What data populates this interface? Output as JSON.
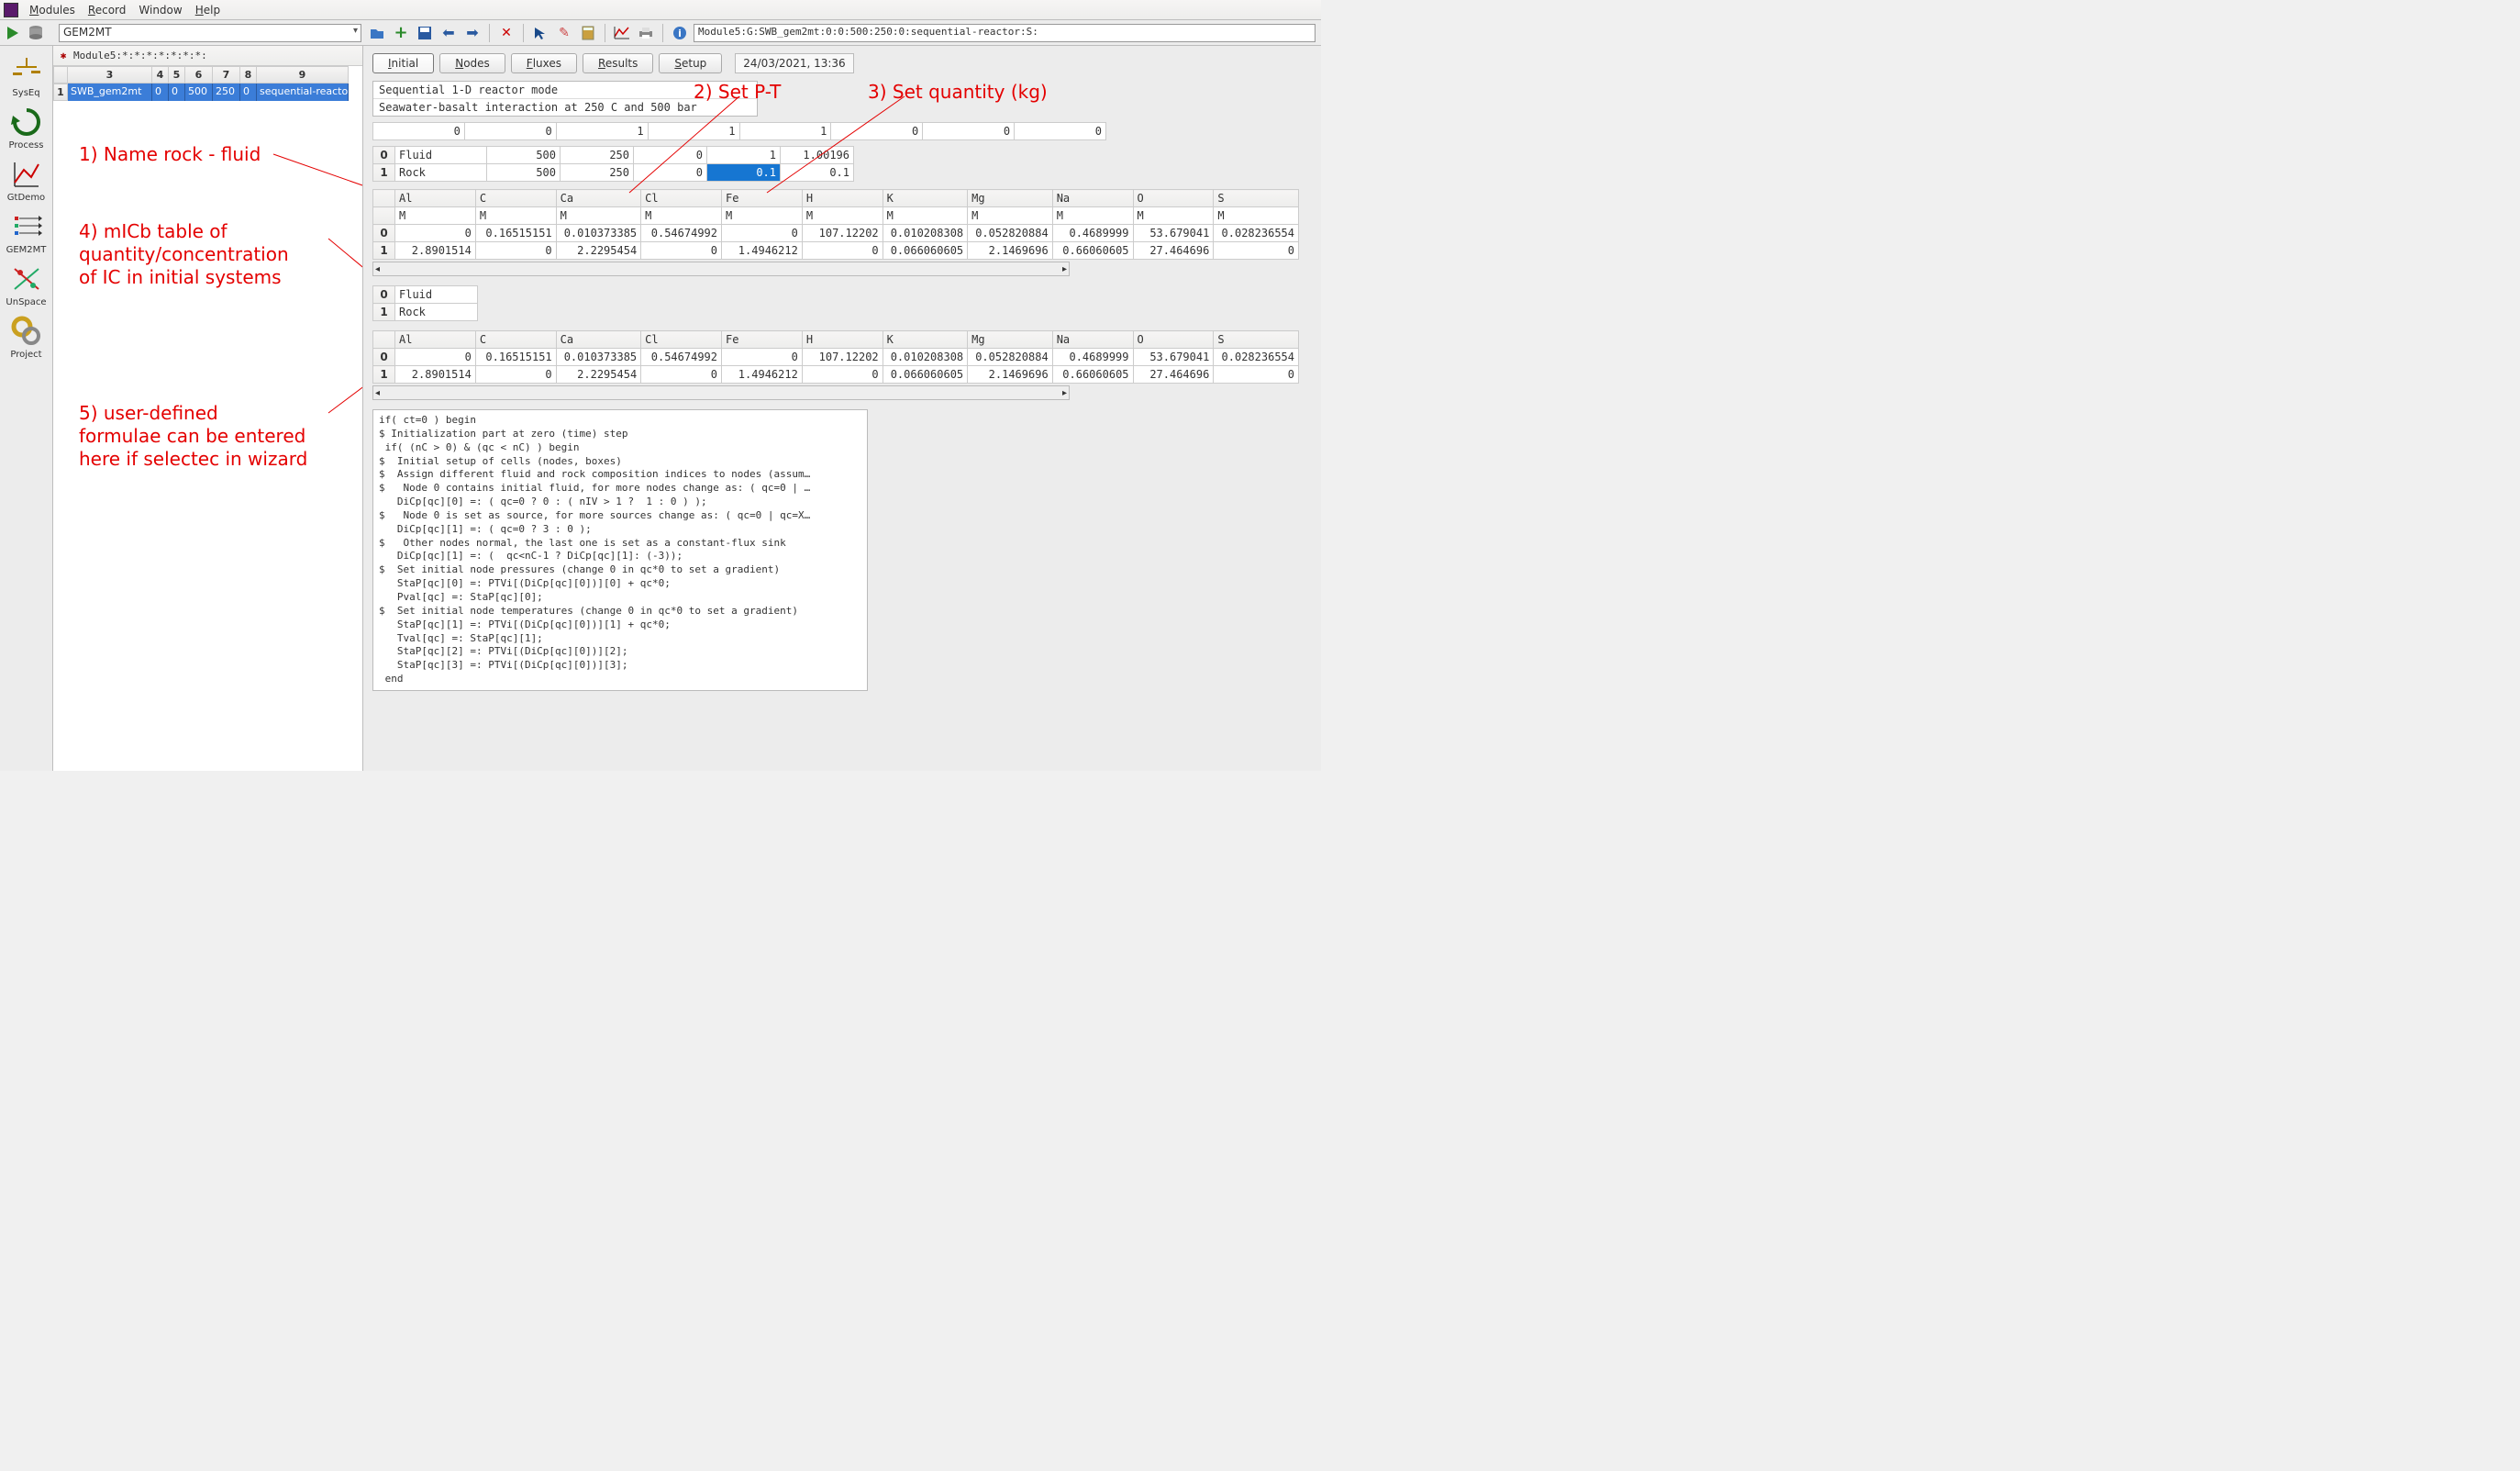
{
  "menu": {
    "modules": "Modules",
    "record": "Record",
    "window": "Window",
    "help": "Help"
  },
  "module_combo": "GEM2MT",
  "module_path": "Module5:G:SWB_gem2mt:0:0:500:250:0:sequential-reactor:S:",
  "record_header_label": "Module5:*:*:*:*:*:*:*:",
  "record_columns": [
    "",
    "3",
    "4",
    "5",
    "6",
    "7",
    "8",
    "9"
  ],
  "record_row": {
    "idx": "1",
    "cells": [
      "SWB_gem2mt",
      "0",
      "0",
      "500",
      "250",
      "0",
      "sequential-reactor"
    ]
  },
  "side": [
    {
      "key": "syseq",
      "label": "SysEq"
    },
    {
      "key": "process",
      "label": "Process"
    },
    {
      "key": "gtdemo",
      "label": "GtDemo"
    },
    {
      "key": "gem2mt",
      "label": "GEM2MT"
    },
    {
      "key": "unspace",
      "label": "UnSpace"
    },
    {
      "key": "project",
      "label": "Project"
    }
  ],
  "tabs": {
    "initial": "Initial",
    "nodes": "Nodes",
    "fluxes": "Fluxes",
    "results": "Results",
    "setup": "Setup"
  },
  "date_label": "24/03/2021, 13:36",
  "desc": {
    "line1": "Sequential 1-D reactor mode",
    "line2": "Seawater-basalt interaction at 250 C and 500 bar"
  },
  "toprow": [
    "0",
    "0",
    "1",
    "1",
    "1",
    "0",
    "0",
    "0"
  ],
  "fluid_rock_cols": 6,
  "fluid_rock": [
    {
      "idx": "0",
      "name": "Fluid",
      "v": [
        "500",
        "250",
        "0",
        "1",
        "1.00196"
      ],
      "sel": 3
    },
    {
      "idx": "1",
      "name": "Rock",
      "v": [
        "500",
        "250",
        "0",
        "0.1",
        "0.1"
      ],
      "sel": 3
    }
  ],
  "ic_headers": [
    "Al",
    "C",
    "Ca",
    "Cl",
    "Fe",
    "H",
    "K",
    "Mg",
    "Na",
    "O",
    "S"
  ],
  "ic_units": [
    "M",
    "M",
    "M",
    "M",
    "M",
    "M",
    "M",
    "M",
    "M",
    "M",
    "M"
  ],
  "ic_rows": [
    {
      "idx": "0",
      "v": [
        "0",
        "0.16515151",
        "0.010373385",
        "0.54674992",
        "0",
        "107.12202",
        "0.010208308",
        "0.052820884",
        "0.4689999",
        "53.679041",
        "0.028236554"
      ]
    },
    {
      "idx": "1",
      "v": [
        "2.8901514",
        "0",
        "2.2295454",
        "0",
        "1.4946212",
        "0",
        "0.066060605",
        "2.1469696",
        "0.66060605",
        "27.464696",
        "0"
      ]
    }
  ],
  "small_table": [
    {
      "idx": "0",
      "name": "Fluid"
    },
    {
      "idx": "1",
      "name": "Rock"
    }
  ],
  "ic_rows2": [
    {
      "idx": "0",
      "v": [
        "0",
        "0.16515151",
        "0.010373385",
        "0.54674992",
        "0",
        "107.12202",
        "0.010208308",
        "0.052820884",
        "0.4689999",
        "53.679041",
        "0.028236554"
      ]
    },
    {
      "idx": "1",
      "v": [
        "2.8901514",
        "0",
        "2.2295454",
        "0",
        "1.4946212",
        "0",
        "0.066060605",
        "2.1469696",
        "0.66060605",
        "27.464696",
        "0"
      ]
    }
  ],
  "script": "if( ct=0 ) begin\n$ Initialization part at zero (time) step\n if( (nC > 0) & (qc < nC) ) begin\n$  Initial setup of cells (nodes, boxes)\n$  Assign different fluid and rock composition indices to nodes (assum…\n$   Node 0 contains initial fluid, for more nodes change as: ( qc=0 | …\n   DiCp[qc][0] =: ( qc=0 ? 0 : ( nIV > 1 ?  1 : 0 ) );\n$   Node 0 is set as source, for more sources change as: ( qc=0 | qc=X…\n   DiCp[qc][1] =: ( qc=0 ? 3 : 0 );\n$   Other nodes normal, the last one is set as a constant-flux sink\n   DiCp[qc][1] =: (  qc<nC-1 ? DiCp[qc][1]: (-3));\n$  Set initial node pressures (change 0 in qc*0 to set a gradient)\n   StaP[qc][0] =: PTVi[(DiCp[qc][0])][0] + qc*0;\n   Pval[qc] =: StaP[qc][0];\n$  Set initial node temperatures (change 0 in qc*0 to set a gradient)\n   StaP[qc][1] =: PTVi[(DiCp[qc][0])][1] + qc*0;\n   Tval[qc] =: StaP[qc][1];\n   StaP[qc][2] =: PTVi[(DiCp[qc][0])][2];\n   StaP[qc][3] =: PTVi[(DiCp[qc][0])][3];\n end",
  "annotations": {
    "a1": "1) Name rock - fluid",
    "a2": "2) Set P-T",
    "a3": "3) Set quantity (kg)",
    "a4": "4) mICb table of\nquantity/concentration\nof IC in initial systems",
    "a5": "5) user-defined\nformulae can be entered\nhere if selectec in wizard"
  }
}
